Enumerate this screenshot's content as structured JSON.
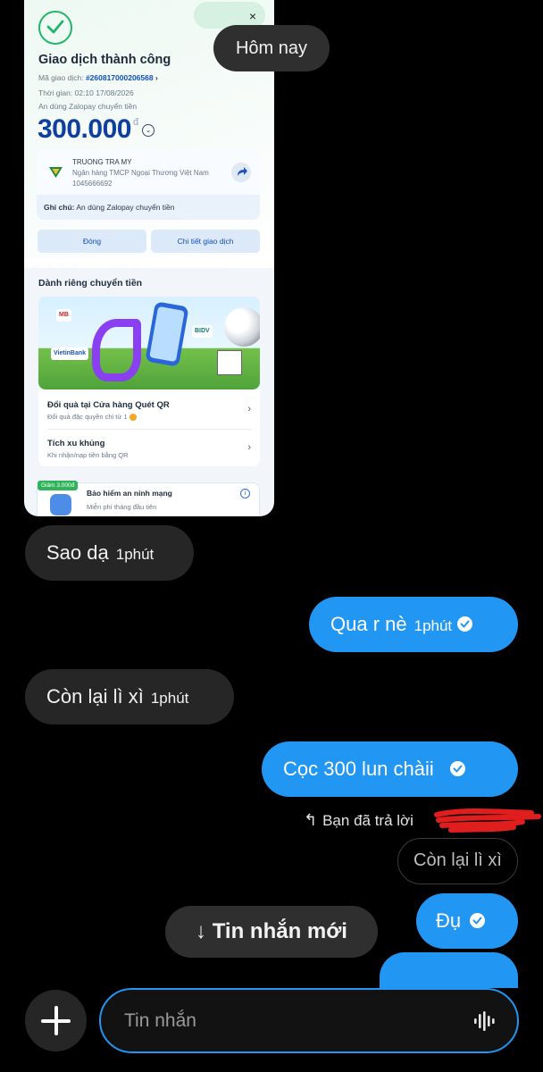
{
  "receipt": {
    "close_icon": "×",
    "title": "Giao dịch thành công",
    "txid_label": "Mã giao dịch:",
    "txid": "#260817000206568",
    "time_label": "Thời gian:",
    "time": "02:10 17/08/2026",
    "memo": "An dùng Zalopay chuyển tiền",
    "amount": "300.000",
    "currency": "đ",
    "recipient_name": "TRUONG TRA MY",
    "recipient_bank": "Ngân hàng TMCP Ngoại Thương Việt Nam",
    "recipient_account": "1045666692",
    "note_label": "Ghi chú:",
    "note": "An dùng Zalopay chuyển tiền",
    "close_button": "Đóng",
    "detail_button": "Chi tiết giao dịch",
    "section_title": "Dành riêng chuyển tiền",
    "banner_chips": [
      "MB",
      "VietinBank",
      "BIDV"
    ],
    "list": [
      {
        "title": "Đổi quà tại Cửa hàng Quét QR",
        "subtitle": "Đổi quà đặc quyền chỉ từ 1"
      },
      {
        "title": "Tích xu khủng",
        "subtitle": "Khi nhận/nạp tiền bằng QR"
      }
    ],
    "insurance_badge": "Giảm 3.000đ",
    "insurance_title": "Bảo hiểm an ninh mạng",
    "insurance_subtitle": "Miễn phí tháng đầu tiên"
  },
  "chat": {
    "date_divider": "Hôm nay",
    "messages": [
      {
        "text": "Sao dạ",
        "time": "1phút",
        "dir": "in"
      },
      {
        "text": "Qua r nè",
        "time": "1phút",
        "dir": "out"
      },
      {
        "text": "Còn lại lì xì",
        "time": "1phút",
        "dir": "in"
      },
      {
        "text": "Cọc 300 lun chàii",
        "time": "",
        "dir": "out"
      },
      {
        "text": "Đụ",
        "time": "",
        "dir": "out"
      }
    ],
    "reply_label": "Bạn đã trả lời",
    "quoted_text": "Còn lại lì xì",
    "new_messages_button": "Tin nhắn mới",
    "new_messages_arrow": "↓"
  },
  "composer": {
    "placeholder": "Tin nhắn"
  },
  "colors": {
    "outgoing_bubble": "#2196f3",
    "incoming_bubble": "#262626",
    "success_green": "#1fb56a",
    "amount_blue": "#0f3f9e"
  },
  "icons": [
    "check-circle-icon",
    "close-icon",
    "share-arrow-icon",
    "reply-arrow-icon",
    "read-check-icon",
    "plus-icon",
    "voice-wave-icon",
    "chevron-right-icon",
    "info-icon"
  ]
}
